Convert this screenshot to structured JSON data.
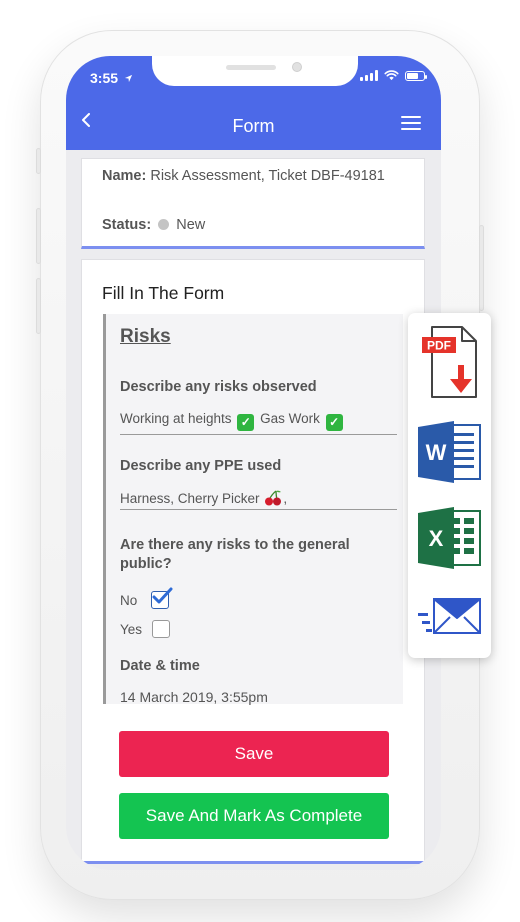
{
  "status_bar": {
    "time": "3:55"
  },
  "header": {
    "title": "Form"
  },
  "info": {
    "name_label": "Name:",
    "name_value": "Risk Assessment, Ticket DBF-49181",
    "status_label": "Status:",
    "status_value": "New"
  },
  "form": {
    "title": "Fill In The Form",
    "section_title": "Risks",
    "q1": {
      "label": "Describe any risks observed",
      "value_part1": "Working at heights",
      "value_part2": "Gas Work"
    },
    "q2": {
      "label": "Describe any PPE used",
      "value": "Harness, Cherry Picker",
      "value_suffix": ","
    },
    "q3": {
      "label": "Are there any risks to the general public?",
      "options": [
        "No",
        "Yes"
      ],
      "selected": "No"
    },
    "q4": {
      "label": "Date & time",
      "value": "14 March 2019, 3:55pm"
    }
  },
  "buttons": {
    "save": "Save",
    "complete": "Save And Mark As Complete"
  },
  "export": {
    "pdf_badge": "PDF",
    "word_letter": "W",
    "excel_letter": "X"
  },
  "colors": {
    "header": "#4c69e8",
    "save": "#ec2451",
    "complete": "#14c451",
    "accent_border": "#7c8ff0",
    "pdf_red": "#e5332a",
    "word_blue": "#2a5aa9",
    "excel_green": "#1e7145",
    "mail_blue": "#2f56c8"
  },
  "icons": [
    "back-icon",
    "menu-icon",
    "location-arrow-icon",
    "signal-icon",
    "wifi-icon",
    "battery-icon",
    "pdf-icon",
    "word-icon",
    "excel-icon",
    "email-icon",
    "checkmark-icon",
    "cherry-icon"
  ]
}
